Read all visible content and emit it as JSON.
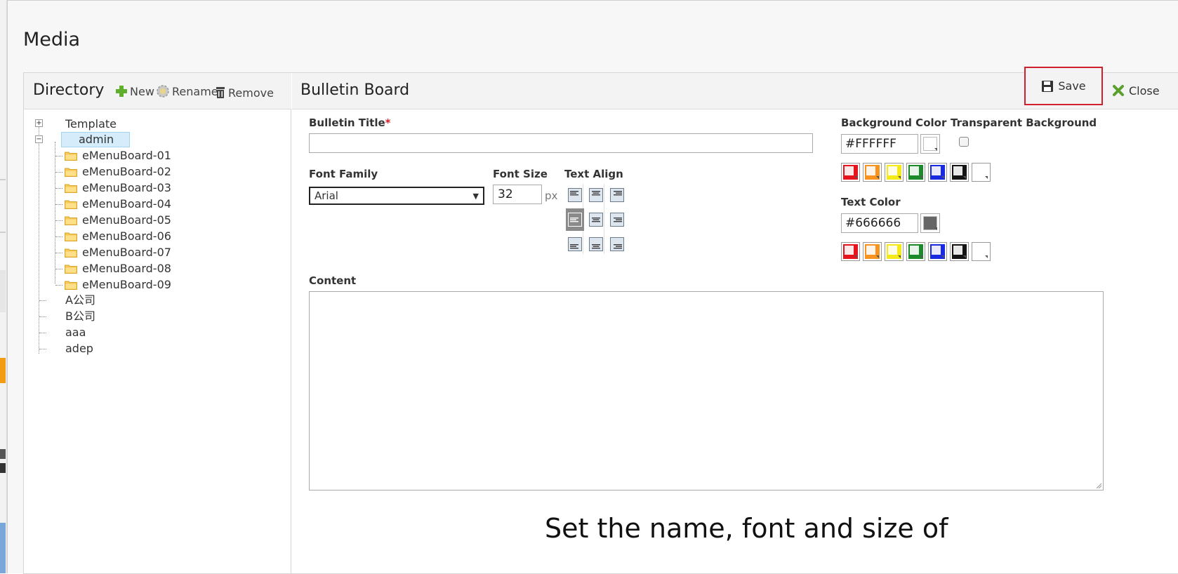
{
  "dialog": {
    "title": "Media"
  },
  "directory": {
    "title": "Directory",
    "toolbar": {
      "new_label": "New",
      "rename_label": "Rename",
      "remove_label": "Remove"
    },
    "tree": {
      "root_nodes": [
        "Template",
        "admin"
      ],
      "admin_children": [
        "eMenuBoard-01",
        "eMenuBoard-02",
        "eMenuBoard-03",
        "eMenuBoard-04",
        "eMenuBoard-05",
        "eMenuBoard-06",
        "eMenuBoard-07",
        "eMenuBoard-08",
        "eMenuBoard-09"
      ],
      "other_nodes": [
        "A公司",
        "B公司",
        "aaa",
        "adep"
      ],
      "selected": "admin"
    }
  },
  "editor": {
    "title": "Bulletin Board",
    "save_label": "Save",
    "close_label": "Close",
    "bulletin_title": {
      "label": "Bulletin Title",
      "required_mark": "*",
      "value": ""
    },
    "font_family": {
      "label": "Font Family",
      "value": "Arial"
    },
    "font_size": {
      "label": "Font Size",
      "value": "32",
      "unit": "px"
    },
    "text_align": {
      "label": "Text Align",
      "selected": "middle-left"
    },
    "background_color": {
      "label": "Background Color",
      "value": "#FFFFFF"
    },
    "transparent_background": {
      "label": "Transparent Background",
      "checked": false
    },
    "text_color": {
      "label": "Text Color",
      "value": "#666666"
    },
    "content": {
      "label": "Content",
      "value": ""
    },
    "swatches": [
      "#e8141d",
      "#f7931e",
      "#f4ea1a",
      "#1a8a2a",
      "#1a2adf",
      "#151515",
      "#ffffff"
    ]
  },
  "caption": "Set the name, font and size of"
}
